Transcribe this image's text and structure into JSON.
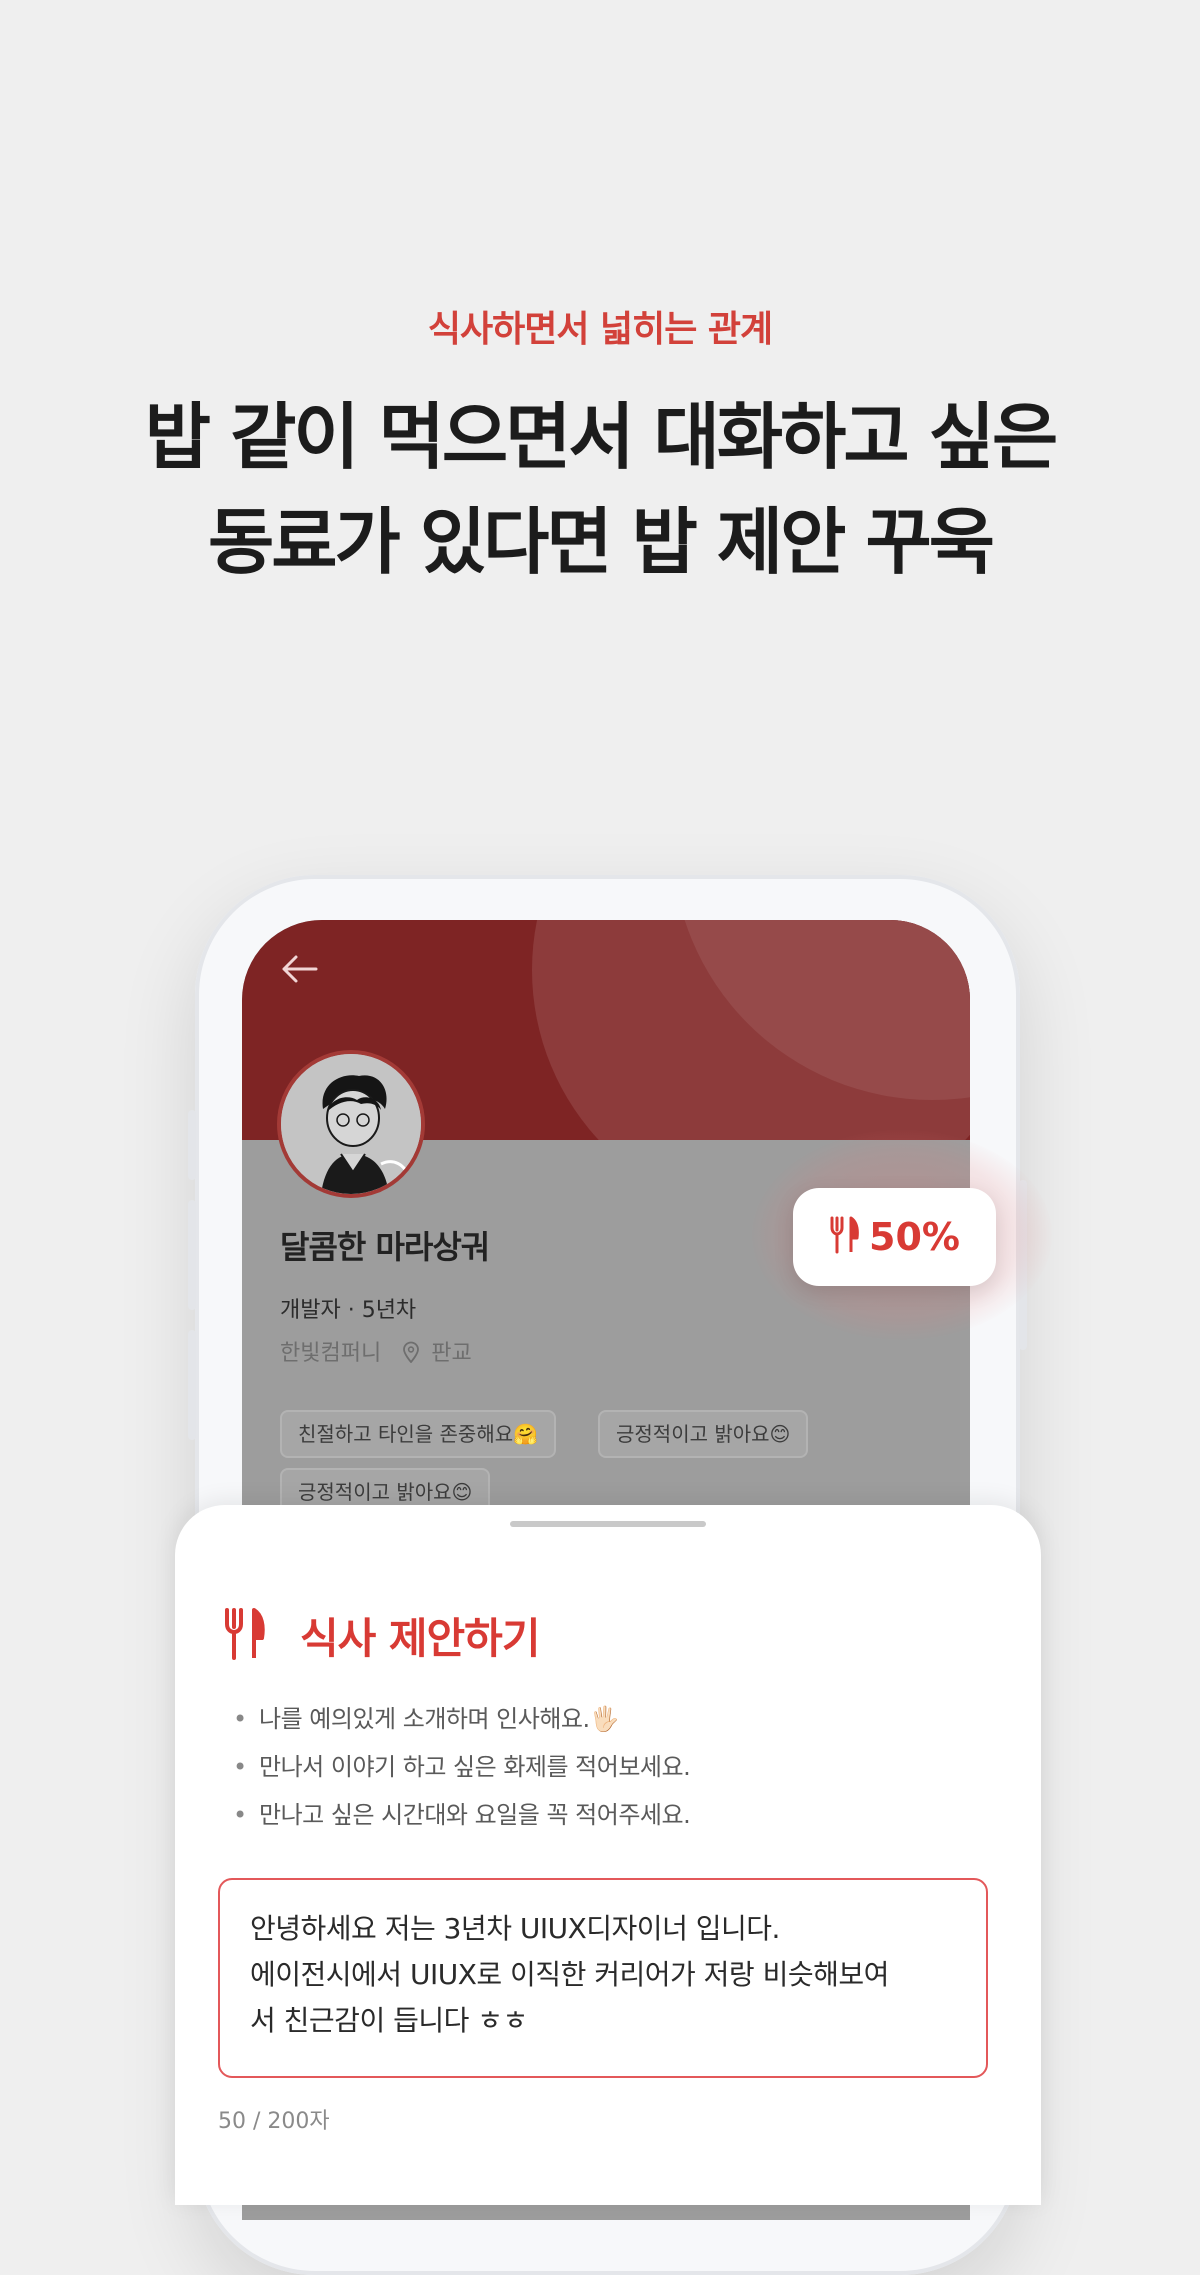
{
  "headline": {
    "kicker": "식사하면서 넓히는 관계",
    "title": "밥 같이 먹으면서 대화하고 싶은\n동료가 있다면 밥 제안 꾸욱"
  },
  "profile": {
    "back_icon": "arrow-left-icon",
    "name": "달콤한 마라상궈",
    "role": "개발자 · 5년차",
    "company": "한빛컴퍼니",
    "location_icon": "location-pin-icon",
    "location": "판교",
    "tags": [
      "친절하고 타인을 존중해요🤗",
      "긍정적이고 밝아요😊",
      "긍정적이고 밝아요😊"
    ]
  },
  "badge": {
    "icon": "fork-knife-icon",
    "value": "50%"
  },
  "sheet": {
    "icon": "fork-knife-icon",
    "title": "식사 제안하기",
    "tips": [
      "나를 예의있게 소개하며 인사해요.🖐🏻",
      "만나서 이야기 하고 싶은 화제를 적어보세요.",
      "만나고 싶은 시간대와 요일을 꼭 적어주세요."
    ],
    "message": "안녕하세요 저는 3년차 UIUX디자이너 입니다.\n에이전시에서 UIUX로 이직한 커리어가 저랑 비슷해보여\n서 친근감이 듭니다 ㅎㅎ",
    "counter": "50 / 200자"
  },
  "colors": {
    "accent": "#d83a34",
    "hero": "#7e2424",
    "background": "#efefef"
  }
}
